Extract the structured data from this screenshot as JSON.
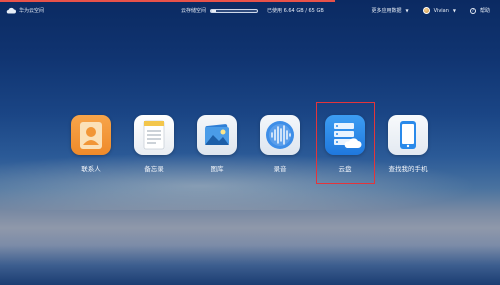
{
  "colors": {
    "accent_line": "#e8524a",
    "highlight": "#e3353b",
    "cloud_blue": "#2a8aea",
    "contacts_orange": "#f29636"
  },
  "header": {
    "brand_label": "华为云空间",
    "storage_label": "云存储空间",
    "storage_used_fraction": 0.1,
    "storage_usage_text": "已使用 6.64 GB / 65 GB",
    "more_apps_label": "更多应用数据",
    "user_name": "Vivian",
    "help_label": "帮助"
  },
  "apps": [
    {
      "label": "联系人",
      "icon": "contacts-icon"
    },
    {
      "label": "备忘录",
      "icon": "notes-icon"
    },
    {
      "label": "图库",
      "icon": "gallery-icon"
    },
    {
      "label": "录音",
      "icon": "recorder-icon"
    },
    {
      "label": "云盘",
      "icon": "cloud-drive-icon",
      "highlighted": true
    },
    {
      "label": "查找我的手机",
      "icon": "find-phone-icon"
    }
  ]
}
